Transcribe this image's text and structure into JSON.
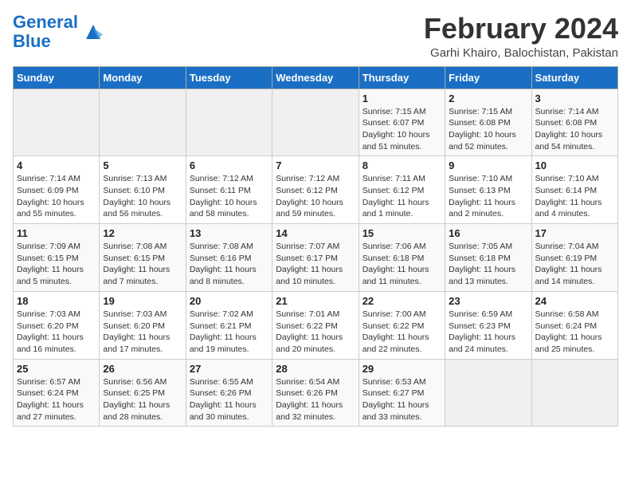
{
  "logo": {
    "line1": "General",
    "line2": "Blue"
  },
  "title": "February 2024",
  "subtitle": "Garhi Khairo, Balochistan, Pakistan",
  "days_of_week": [
    "Sunday",
    "Monday",
    "Tuesday",
    "Wednesday",
    "Thursday",
    "Friday",
    "Saturday"
  ],
  "weeks": [
    [
      {
        "day": "",
        "info": ""
      },
      {
        "day": "",
        "info": ""
      },
      {
        "day": "",
        "info": ""
      },
      {
        "day": "",
        "info": ""
      },
      {
        "day": "1",
        "info": "Sunrise: 7:15 AM\nSunset: 6:07 PM\nDaylight: 10 hours and 51 minutes."
      },
      {
        "day": "2",
        "info": "Sunrise: 7:15 AM\nSunset: 6:08 PM\nDaylight: 10 hours and 52 minutes."
      },
      {
        "day": "3",
        "info": "Sunrise: 7:14 AM\nSunset: 6:08 PM\nDaylight: 10 hours and 54 minutes."
      }
    ],
    [
      {
        "day": "4",
        "info": "Sunrise: 7:14 AM\nSunset: 6:09 PM\nDaylight: 10 hours and 55 minutes."
      },
      {
        "day": "5",
        "info": "Sunrise: 7:13 AM\nSunset: 6:10 PM\nDaylight: 10 hours and 56 minutes."
      },
      {
        "day": "6",
        "info": "Sunrise: 7:12 AM\nSunset: 6:11 PM\nDaylight: 10 hours and 58 minutes."
      },
      {
        "day": "7",
        "info": "Sunrise: 7:12 AM\nSunset: 6:12 PM\nDaylight: 10 hours and 59 minutes."
      },
      {
        "day": "8",
        "info": "Sunrise: 7:11 AM\nSunset: 6:12 PM\nDaylight: 11 hours and 1 minute."
      },
      {
        "day": "9",
        "info": "Sunrise: 7:10 AM\nSunset: 6:13 PM\nDaylight: 11 hours and 2 minutes."
      },
      {
        "day": "10",
        "info": "Sunrise: 7:10 AM\nSunset: 6:14 PM\nDaylight: 11 hours and 4 minutes."
      }
    ],
    [
      {
        "day": "11",
        "info": "Sunrise: 7:09 AM\nSunset: 6:15 PM\nDaylight: 11 hours and 5 minutes."
      },
      {
        "day": "12",
        "info": "Sunrise: 7:08 AM\nSunset: 6:15 PM\nDaylight: 11 hours and 7 minutes."
      },
      {
        "day": "13",
        "info": "Sunrise: 7:08 AM\nSunset: 6:16 PM\nDaylight: 11 hours and 8 minutes."
      },
      {
        "day": "14",
        "info": "Sunrise: 7:07 AM\nSunset: 6:17 PM\nDaylight: 11 hours and 10 minutes."
      },
      {
        "day": "15",
        "info": "Sunrise: 7:06 AM\nSunset: 6:18 PM\nDaylight: 11 hours and 11 minutes."
      },
      {
        "day": "16",
        "info": "Sunrise: 7:05 AM\nSunset: 6:18 PM\nDaylight: 11 hours and 13 minutes."
      },
      {
        "day": "17",
        "info": "Sunrise: 7:04 AM\nSunset: 6:19 PM\nDaylight: 11 hours and 14 minutes."
      }
    ],
    [
      {
        "day": "18",
        "info": "Sunrise: 7:03 AM\nSunset: 6:20 PM\nDaylight: 11 hours and 16 minutes."
      },
      {
        "day": "19",
        "info": "Sunrise: 7:03 AM\nSunset: 6:20 PM\nDaylight: 11 hours and 17 minutes."
      },
      {
        "day": "20",
        "info": "Sunrise: 7:02 AM\nSunset: 6:21 PM\nDaylight: 11 hours and 19 minutes."
      },
      {
        "day": "21",
        "info": "Sunrise: 7:01 AM\nSunset: 6:22 PM\nDaylight: 11 hours and 20 minutes."
      },
      {
        "day": "22",
        "info": "Sunrise: 7:00 AM\nSunset: 6:22 PM\nDaylight: 11 hours and 22 minutes."
      },
      {
        "day": "23",
        "info": "Sunrise: 6:59 AM\nSunset: 6:23 PM\nDaylight: 11 hours and 24 minutes."
      },
      {
        "day": "24",
        "info": "Sunrise: 6:58 AM\nSunset: 6:24 PM\nDaylight: 11 hours and 25 minutes."
      }
    ],
    [
      {
        "day": "25",
        "info": "Sunrise: 6:57 AM\nSunset: 6:24 PM\nDaylight: 11 hours and 27 minutes."
      },
      {
        "day": "26",
        "info": "Sunrise: 6:56 AM\nSunset: 6:25 PM\nDaylight: 11 hours and 28 minutes."
      },
      {
        "day": "27",
        "info": "Sunrise: 6:55 AM\nSunset: 6:26 PM\nDaylight: 11 hours and 30 minutes."
      },
      {
        "day": "28",
        "info": "Sunrise: 6:54 AM\nSunset: 6:26 PM\nDaylight: 11 hours and 32 minutes."
      },
      {
        "day": "29",
        "info": "Sunrise: 6:53 AM\nSunset: 6:27 PM\nDaylight: 11 hours and 33 minutes."
      },
      {
        "day": "",
        "info": ""
      },
      {
        "day": "",
        "info": ""
      }
    ]
  ]
}
